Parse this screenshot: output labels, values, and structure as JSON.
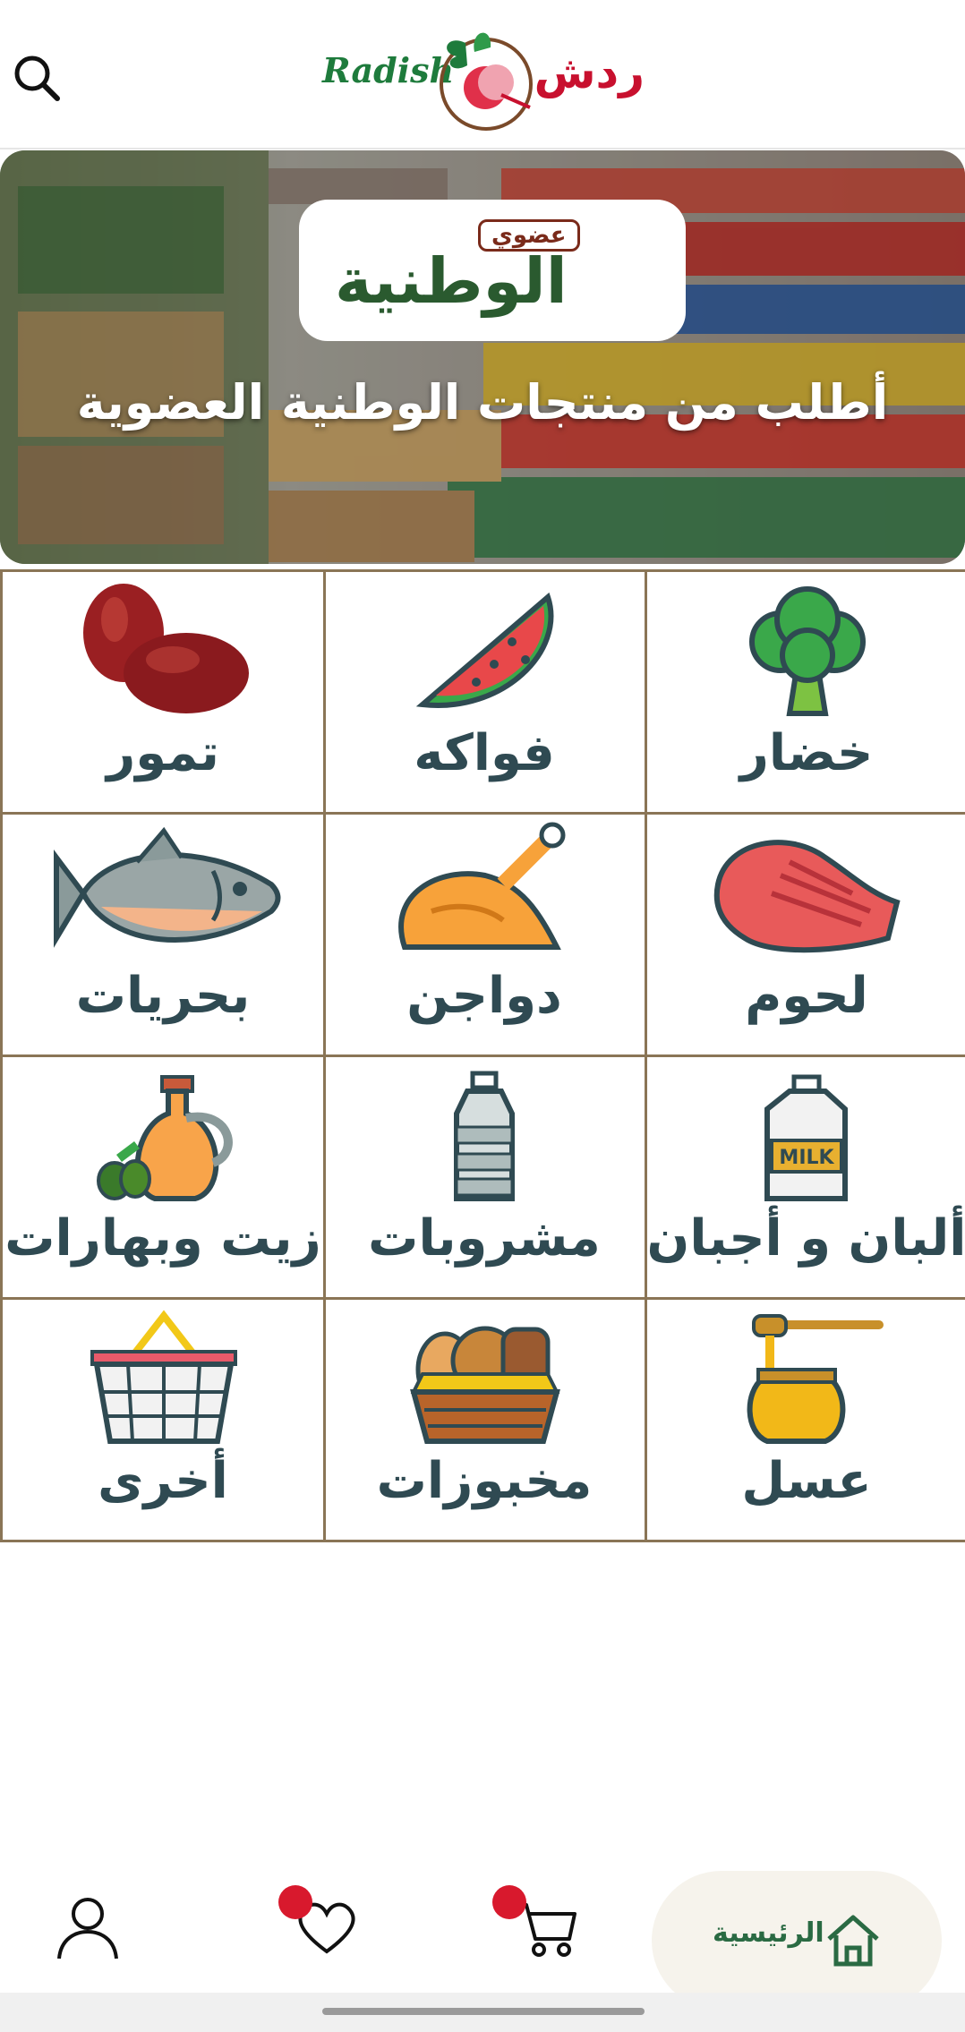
{
  "header": {
    "logo_latin": "Radish",
    "logo_arabic": "ردش",
    "search_icon": "search-icon"
  },
  "banner": {
    "badge": "عضوي",
    "brand": "الوطنية",
    "title": "أطلب من منتجات الوطنية العضوية",
    "active_slide": 1,
    "slide_count": 1
  },
  "categories": [
    {
      "label": "خضار",
      "icon": "broccoli-icon"
    },
    {
      "label": "فواكه",
      "icon": "watermelon-icon"
    },
    {
      "label": "تمور",
      "icon": "dates-icon"
    },
    {
      "label": "لحوم",
      "icon": "steak-icon"
    },
    {
      "label": "دواجن",
      "icon": "chicken-icon"
    },
    {
      "label": "بحريات",
      "icon": "fish-icon"
    },
    {
      "label": "ألبان و أجبان",
      "icon": "milk-icon",
      "icon_text": "MILK"
    },
    {
      "label": "مشروبات",
      "icon": "water-bottle-icon"
    },
    {
      "label": "زيت وبهارات",
      "icon": "oil-jar-icon"
    },
    {
      "label": "عسل",
      "icon": "honey-jar-icon"
    },
    {
      "label": "مخبوزات",
      "icon": "bread-basket-icon"
    },
    {
      "label": "أخرى",
      "icon": "shopping-basket-icon"
    }
  ],
  "bottom_nav": {
    "home_label": "الرئيسية",
    "items": [
      "home-icon",
      "cart-icon",
      "heart-icon",
      "user-icon"
    ]
  },
  "colors": {
    "brand_green": "#1e7b3c",
    "brand_red": "#c8102e",
    "grid_border": "#8a7556",
    "label_text": "#2f4a52",
    "badge_red": "#d8192d"
  }
}
